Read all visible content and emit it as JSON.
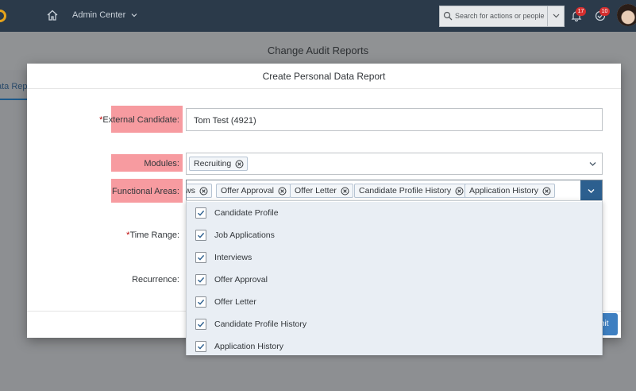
{
  "shell": {
    "title": "Admin Center",
    "search_placeholder": "Search for actions or people",
    "notifications_count": "17",
    "todo_count": "10"
  },
  "background": {
    "page_title": "Change Audit Reports",
    "tab_label": "ata Repo"
  },
  "dialog": {
    "title": "Create Personal Data Report",
    "fields": {
      "external_candidate_label": "External Candidate:",
      "external_candidate_value": "Tom Test (4921)",
      "modules_label": "Modules:",
      "modules_tokens": [
        "Recruiting"
      ],
      "functional_areas_label": "Functional Areas:",
      "functional_areas_tokens": [
        "ws",
        "Offer Approval",
        "Offer Letter",
        "Candidate Profile History",
        "Application History"
      ],
      "time_range_label": "Time Range:",
      "recurrence_label": "Recurrence:"
    },
    "submit_label": "nit"
  },
  "dropdown": {
    "items": [
      {
        "label": "Candidate Profile",
        "checked": true
      },
      {
        "label": "Job Applications",
        "checked": true
      },
      {
        "label": "Interviews",
        "checked": true
      },
      {
        "label": "Offer Approval",
        "checked": true
      },
      {
        "label": "Offer Letter",
        "checked": true
      },
      {
        "label": "Candidate Profile History",
        "checked": true
      },
      {
        "label": "Application History",
        "checked": true
      }
    ]
  },
  "colors": {
    "shell_bg": "#2b3a4a",
    "highlight": "#f79ba0",
    "accent": "#1f5a8a",
    "required": "#bb0000"
  }
}
